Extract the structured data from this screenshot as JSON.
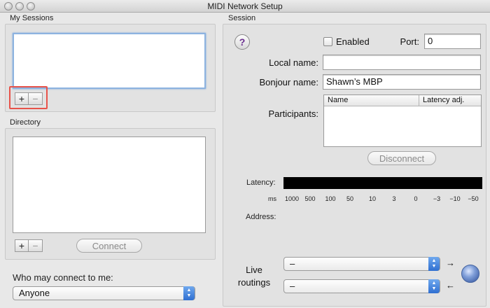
{
  "window": {
    "title": "MIDI Network Setup"
  },
  "my_sessions": {
    "label": "My Sessions",
    "add": "+",
    "remove": "−"
  },
  "directory": {
    "label": "Directory",
    "add": "+",
    "remove": "−",
    "connect": "Connect"
  },
  "who": {
    "label": "Who may connect to me:",
    "value": "Anyone"
  },
  "session": {
    "label": "Session",
    "help": "?",
    "enabled_label": "Enabled",
    "enabled": false,
    "port_label": "Port:",
    "port_value": "0",
    "local_name_label": "Local name:",
    "local_name_value": "",
    "bonjour_label": "Bonjour name:",
    "bonjour_value": "Shawn’s MBP",
    "participants_label": "Participants:",
    "participants_columns": [
      "Name",
      "Latency adj."
    ],
    "disconnect": "Disconnect",
    "latency_label": "Latency:",
    "latency_unit": "ms",
    "latency_ticks": [
      "1000",
      "500",
      "100",
      "50",
      "10",
      "3",
      "0",
      "−3",
      "−10",
      "−50"
    ],
    "address_label": "Address:",
    "live_routings_label_1": "Live",
    "live_routings_label_2": "routings",
    "routing_in_value": "–",
    "routing_out_value": "–",
    "arrow_right": "→",
    "arrow_left": "←"
  },
  "icons": [
    "close-icon",
    "minimize-icon",
    "zoom-icon",
    "help-icon",
    "popup-arrows-icon",
    "network-globe-icon"
  ]
}
